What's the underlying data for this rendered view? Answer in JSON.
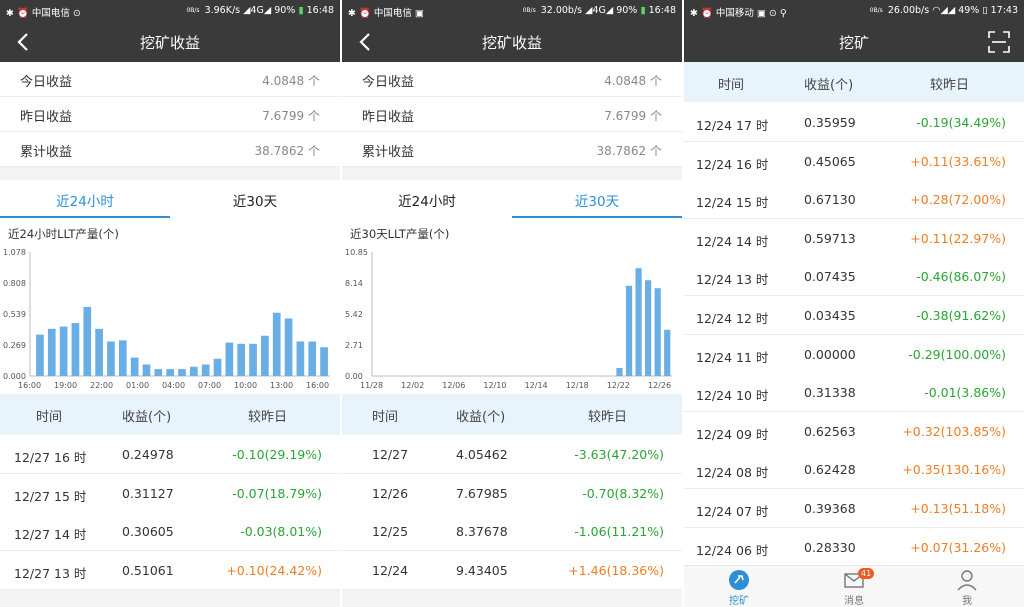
{
  "p1": {
    "status": {
      "carrier": "中国电信",
      "net": "3.96K/s",
      "net_small": "0B/s",
      "signal": "4G",
      "battery": "90%",
      "time": "16:48"
    },
    "title": "挖矿收益",
    "summary": [
      {
        "label": "今日收益",
        "value": "4.0848 个"
      },
      {
        "label": "昨日收益",
        "value": "7.6799 个"
      },
      {
        "label": "累计收益",
        "value": "38.7862 个"
      }
    ],
    "tabs": [
      "近24小时",
      "近30天"
    ],
    "active_tab": 0,
    "chart_title": "近24小时LLT产量(个)",
    "table_header": [
      "时间",
      "收益(个)",
      "较昨日"
    ],
    "rows": [
      {
        "time": "12/27 16 时",
        "value": "0.24978",
        "change": "-0.10(29.19%)"
      },
      {
        "time": "12/27 15 时",
        "value": "0.31127",
        "change": "-0.07(18.79%)"
      },
      {
        "time": "12/27 14 时",
        "value": "0.30605",
        "change": "-0.03(8.01%)"
      },
      {
        "time": "12/27 13 时",
        "value": "0.51061",
        "change": "+0.10(24.42%)"
      }
    ]
  },
  "p2": {
    "status": {
      "carrier": "中国电信",
      "net": "32.00b/s",
      "net_small": "0B/s",
      "signal": "4G",
      "battery": "90%",
      "time": "16:48"
    },
    "title": "挖矿收益",
    "summary": [
      {
        "label": "今日收益",
        "value": "4.0848 个"
      },
      {
        "label": "昨日收益",
        "value": "7.6799 个"
      },
      {
        "label": "累计收益",
        "value": "38.7862 个"
      }
    ],
    "tabs": [
      "近24小时",
      "近30天"
    ],
    "active_tab": 1,
    "chart_title": "近30天LLT产量(个)",
    "table_header": [
      "时间",
      "收益(个)",
      "较昨日"
    ],
    "rows": [
      {
        "time": "12/27",
        "value": "4.05462",
        "change": "-3.63(47.20%)"
      },
      {
        "time": "12/26",
        "value": "7.67985",
        "change": "-0.70(8.32%)"
      },
      {
        "time": "12/25",
        "value": "8.37678",
        "change": "-1.06(11.21%)"
      },
      {
        "time": "12/24",
        "value": "9.43405",
        "change": "+1.46(18.36%)"
      }
    ]
  },
  "p3": {
    "status": {
      "carrier": "中国移动",
      "net": "26.00b/s",
      "net_small": "0B/s",
      "signal": "",
      "battery": "49%",
      "time": "17:43"
    },
    "title": "挖矿",
    "table_header": [
      "时间",
      "收益(个)",
      "较昨日"
    ],
    "rows": [
      {
        "time": "12/24 17 时",
        "value": "0.35959",
        "change": "-0.19(34.49%)"
      },
      {
        "time": "12/24 16 时",
        "value": "0.45065",
        "change": "+0.11(33.61%)"
      },
      {
        "time": "12/24 15 时",
        "value": "0.67130",
        "change": "+0.28(72.00%)"
      },
      {
        "time": "12/24 14 时",
        "value": "0.59713",
        "change": "+0.11(22.97%)"
      },
      {
        "time": "12/24 13 时",
        "value": "0.07435",
        "change": "-0.46(86.07%)"
      },
      {
        "time": "12/24 12 时",
        "value": "0.03435",
        "change": "-0.38(91.62%)"
      },
      {
        "time": "12/24 11 时",
        "value": "0.00000",
        "change": "-0.29(100.00%)"
      },
      {
        "time": "12/24 10 时",
        "value": "0.31338",
        "change": "-0.01(3.86%)"
      },
      {
        "time": "12/24 09 时",
        "value": "0.62563",
        "change": "+0.32(103.85%)"
      },
      {
        "time": "12/24 08 时",
        "value": "0.62428",
        "change": "+0.35(130.16%)"
      },
      {
        "time": "12/24 07 时",
        "value": "0.39368",
        "change": "+0.13(51.18%)"
      },
      {
        "time": "12/24 06 时",
        "value": "0.28330",
        "change": "+0.07(31.26%)"
      }
    ],
    "tabbar": [
      {
        "label": "挖矿",
        "icon": "mining-icon"
      },
      {
        "label": "消息",
        "icon": "mail-icon",
        "badge": "41"
      },
      {
        "label": "我",
        "icon": "user-icon"
      }
    ]
  },
  "colors": {
    "accent": "#2e8fd6",
    "positive": "#ef7d27",
    "negative": "#2aa436",
    "bar": "#6aaee6",
    "header_bg": "#3a3a3a"
  },
  "chart_data": [
    {
      "type": "bar",
      "title": "近24小时LLT产量(个)",
      "yticks": [
        "0.000",
        "0.269",
        "0.539",
        "0.808",
        "1.078"
      ],
      "ylim": [
        0,
        1.078
      ],
      "xticks": [
        "16:00",
        "19:00",
        "22:00",
        "01:00",
        "04:00",
        "07:00",
        "10:00",
        "13:00",
        "16:00"
      ],
      "values": [
        0.36,
        0.41,
        0.43,
        0.46,
        0.6,
        0.41,
        0.3,
        0.31,
        0.16,
        0.1,
        0.06,
        0.06,
        0.06,
        0.08,
        0.1,
        0.15,
        0.29,
        0.28,
        0.28,
        0.35,
        0.55,
        0.5,
        0.3,
        0.3,
        0.25
      ]
    },
    {
      "type": "bar",
      "title": "近30天LLT产量(个)",
      "yticks": [
        "0.00",
        "2.71",
        "5.42",
        "8.14",
        "10.85"
      ],
      "ylim": [
        0,
        10.85
      ],
      "xticks": [
        "11/28",
        "12/02",
        "12/06",
        "12/10",
        "12/14",
        "12/18",
        "12/22",
        "12/26"
      ],
      "values": [
        0,
        0,
        0,
        0,
        0,
        0,
        0,
        0,
        0,
        0,
        0,
        0,
        0,
        0,
        0,
        0,
        0,
        0,
        0,
        0,
        0,
        0,
        0,
        0,
        0,
        0.7,
        7.9,
        9.43,
        8.38,
        7.68,
        4.05
      ]
    }
  ]
}
